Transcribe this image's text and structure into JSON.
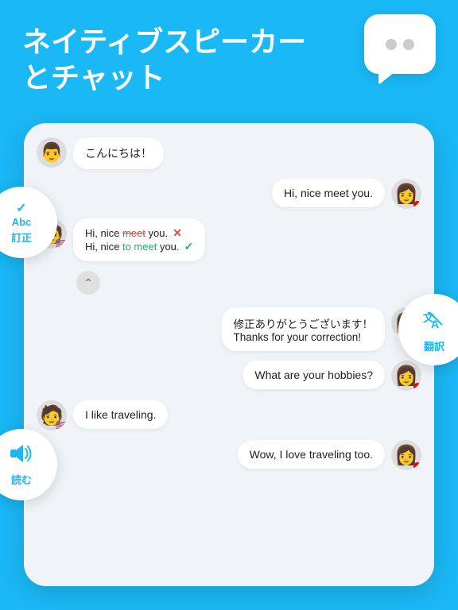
{
  "header": {
    "line1": "ネイティブスピーカー",
    "line2": "とチャット"
  },
  "badges": {
    "correction_label": "訂正",
    "translate_label": "翻訳",
    "read_label": "読む"
  },
  "messages": [
    {
      "id": "msg1",
      "side": "left",
      "avatar": "person_male1",
      "text": "こんにちは！"
    },
    {
      "id": "msg2",
      "side": "right",
      "avatar": "person_female1",
      "text": "Hi, nice meet you."
    },
    {
      "id": "msg3",
      "side": "left",
      "avatar": "person_male1",
      "type": "correction",
      "wrong": "Hi, nice meet you.",
      "correct": "Hi, nice to meet you."
    },
    {
      "id": "msg4",
      "side": "right",
      "avatar": "person_female1",
      "line1": "修正ありがとうございます！",
      "line2": "Thanks for your correction!"
    },
    {
      "id": "msg5",
      "side": "right",
      "avatar": "person_female1",
      "text": "What are your hobbies?"
    },
    {
      "id": "msg6",
      "side": "left",
      "avatar": "person_male2",
      "text": "I like traveling."
    },
    {
      "id": "msg7",
      "side": "right",
      "avatar": "person_female1",
      "text": "Wow, I love traveling too."
    }
  ]
}
